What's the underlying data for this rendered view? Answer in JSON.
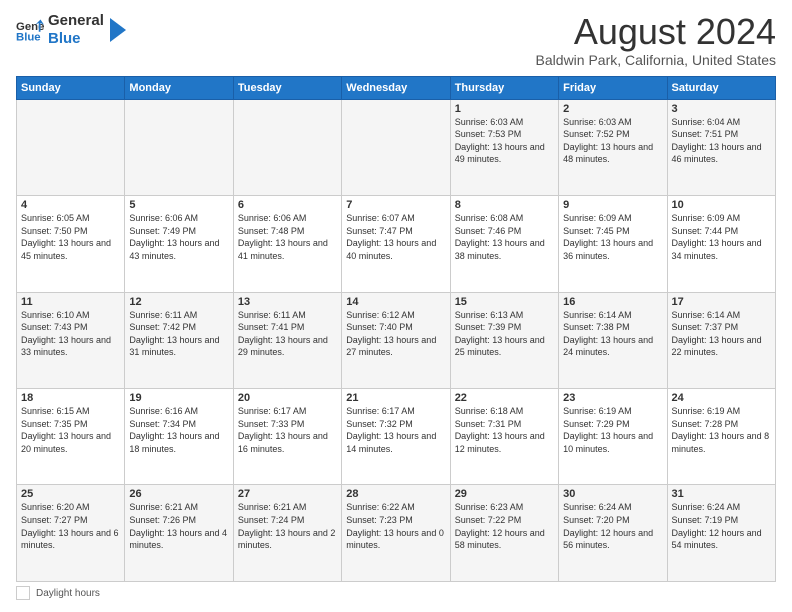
{
  "header": {
    "logo_general": "General",
    "logo_blue": "Blue",
    "title": "August 2024",
    "location": "Baldwin Park, California, United States"
  },
  "days_of_week": [
    "Sunday",
    "Monday",
    "Tuesday",
    "Wednesday",
    "Thursday",
    "Friday",
    "Saturday"
  ],
  "weeks": [
    [
      {
        "day": "",
        "info": ""
      },
      {
        "day": "",
        "info": ""
      },
      {
        "day": "",
        "info": ""
      },
      {
        "day": "",
        "info": ""
      },
      {
        "day": "1",
        "info": "Sunrise: 6:03 AM\nSunset: 7:53 PM\nDaylight: 13 hours and 49 minutes."
      },
      {
        "day": "2",
        "info": "Sunrise: 6:03 AM\nSunset: 7:52 PM\nDaylight: 13 hours and 48 minutes."
      },
      {
        "day": "3",
        "info": "Sunrise: 6:04 AM\nSunset: 7:51 PM\nDaylight: 13 hours and 46 minutes."
      }
    ],
    [
      {
        "day": "4",
        "info": "Sunrise: 6:05 AM\nSunset: 7:50 PM\nDaylight: 13 hours and 45 minutes."
      },
      {
        "day": "5",
        "info": "Sunrise: 6:06 AM\nSunset: 7:49 PM\nDaylight: 13 hours and 43 minutes."
      },
      {
        "day": "6",
        "info": "Sunrise: 6:06 AM\nSunset: 7:48 PM\nDaylight: 13 hours and 41 minutes."
      },
      {
        "day": "7",
        "info": "Sunrise: 6:07 AM\nSunset: 7:47 PM\nDaylight: 13 hours and 40 minutes."
      },
      {
        "day": "8",
        "info": "Sunrise: 6:08 AM\nSunset: 7:46 PM\nDaylight: 13 hours and 38 minutes."
      },
      {
        "day": "9",
        "info": "Sunrise: 6:09 AM\nSunset: 7:45 PM\nDaylight: 13 hours and 36 minutes."
      },
      {
        "day": "10",
        "info": "Sunrise: 6:09 AM\nSunset: 7:44 PM\nDaylight: 13 hours and 34 minutes."
      }
    ],
    [
      {
        "day": "11",
        "info": "Sunrise: 6:10 AM\nSunset: 7:43 PM\nDaylight: 13 hours and 33 minutes."
      },
      {
        "day": "12",
        "info": "Sunrise: 6:11 AM\nSunset: 7:42 PM\nDaylight: 13 hours and 31 minutes."
      },
      {
        "day": "13",
        "info": "Sunrise: 6:11 AM\nSunset: 7:41 PM\nDaylight: 13 hours and 29 minutes."
      },
      {
        "day": "14",
        "info": "Sunrise: 6:12 AM\nSunset: 7:40 PM\nDaylight: 13 hours and 27 minutes."
      },
      {
        "day": "15",
        "info": "Sunrise: 6:13 AM\nSunset: 7:39 PM\nDaylight: 13 hours and 25 minutes."
      },
      {
        "day": "16",
        "info": "Sunrise: 6:14 AM\nSunset: 7:38 PM\nDaylight: 13 hours and 24 minutes."
      },
      {
        "day": "17",
        "info": "Sunrise: 6:14 AM\nSunset: 7:37 PM\nDaylight: 13 hours and 22 minutes."
      }
    ],
    [
      {
        "day": "18",
        "info": "Sunrise: 6:15 AM\nSunset: 7:35 PM\nDaylight: 13 hours and 20 minutes."
      },
      {
        "day": "19",
        "info": "Sunrise: 6:16 AM\nSunset: 7:34 PM\nDaylight: 13 hours and 18 minutes."
      },
      {
        "day": "20",
        "info": "Sunrise: 6:17 AM\nSunset: 7:33 PM\nDaylight: 13 hours and 16 minutes."
      },
      {
        "day": "21",
        "info": "Sunrise: 6:17 AM\nSunset: 7:32 PM\nDaylight: 13 hours and 14 minutes."
      },
      {
        "day": "22",
        "info": "Sunrise: 6:18 AM\nSunset: 7:31 PM\nDaylight: 13 hours and 12 minutes."
      },
      {
        "day": "23",
        "info": "Sunrise: 6:19 AM\nSunset: 7:29 PM\nDaylight: 13 hours and 10 minutes."
      },
      {
        "day": "24",
        "info": "Sunrise: 6:19 AM\nSunset: 7:28 PM\nDaylight: 13 hours and 8 minutes."
      }
    ],
    [
      {
        "day": "25",
        "info": "Sunrise: 6:20 AM\nSunset: 7:27 PM\nDaylight: 13 hours and 6 minutes."
      },
      {
        "day": "26",
        "info": "Sunrise: 6:21 AM\nSunset: 7:26 PM\nDaylight: 13 hours and 4 minutes."
      },
      {
        "day": "27",
        "info": "Sunrise: 6:21 AM\nSunset: 7:24 PM\nDaylight: 13 hours and 2 minutes."
      },
      {
        "day": "28",
        "info": "Sunrise: 6:22 AM\nSunset: 7:23 PM\nDaylight: 13 hours and 0 minutes."
      },
      {
        "day": "29",
        "info": "Sunrise: 6:23 AM\nSunset: 7:22 PM\nDaylight: 12 hours and 58 minutes."
      },
      {
        "day": "30",
        "info": "Sunrise: 6:24 AM\nSunset: 7:20 PM\nDaylight: 12 hours and 56 minutes."
      },
      {
        "day": "31",
        "info": "Sunrise: 6:24 AM\nSunset: 7:19 PM\nDaylight: 12 hours and 54 minutes."
      }
    ]
  ],
  "footer": {
    "daylight_label": "Daylight hours"
  }
}
